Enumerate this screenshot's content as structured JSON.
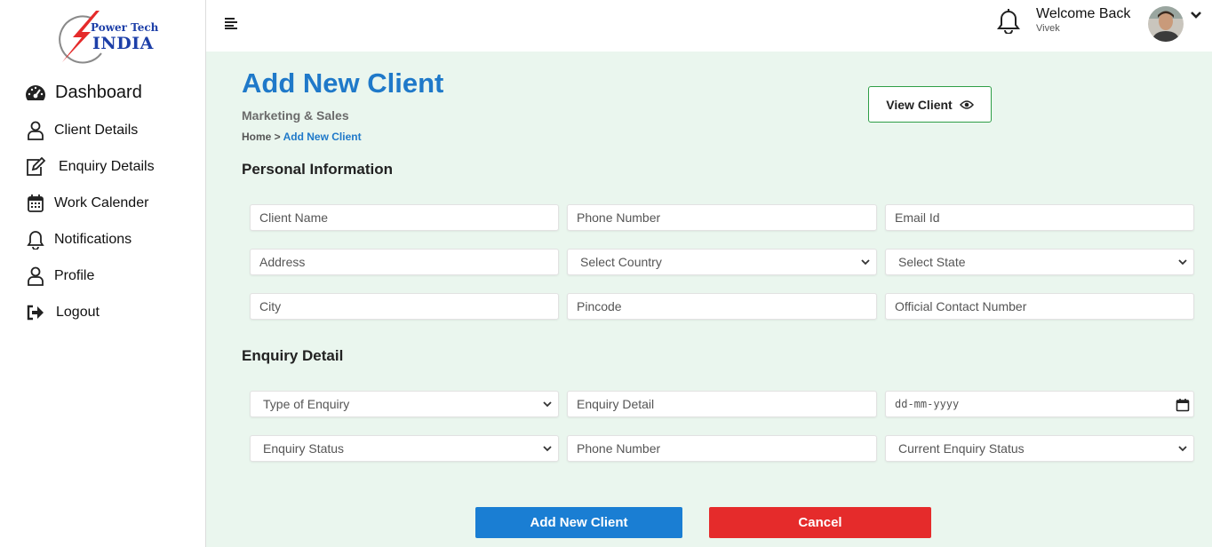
{
  "brand": {
    "line1": "Power Tech",
    "line2": "INDIA"
  },
  "sidebar": {
    "items": [
      {
        "label": "Dashboard",
        "icon": "speedometer-icon"
      },
      {
        "label": "Client Details",
        "icon": "user-icon"
      },
      {
        "label": "Enquiry Details",
        "icon": "edit-icon"
      },
      {
        "label": "Work Calender",
        "icon": "calendar-icon"
      },
      {
        "label": "Notifications",
        "icon": "bell-icon"
      },
      {
        "label": "Profile",
        "icon": "user-icon"
      },
      {
        "label": "Logout",
        "icon": "logout-icon"
      }
    ]
  },
  "header": {
    "welcome": "Welcome Back",
    "username": "Vivek"
  },
  "page": {
    "title": "Add New Client",
    "subtitle": "Marketing & Sales",
    "breadcrumb_home": "Home",
    "breadcrumb_sep": " > ",
    "breadcrumb_current": "Add New Client",
    "view_client_label": "View Client"
  },
  "personal": {
    "title": "Personal Information",
    "client_name": "Client Name",
    "phone": "Phone Number",
    "email": "Email Id",
    "address": "Address",
    "country": "Select Country",
    "state": "Select State",
    "city": "City",
    "pincode": "Pincode",
    "official_contact": "Official Contact Number"
  },
  "enquiry": {
    "title": "Enquiry Detail",
    "type": "Type of Enquiry",
    "detail": "Enquiry Detail",
    "date": "dd-mm-yyyy",
    "status": "Enquiry Status",
    "phone": "Phone Number",
    "current_status": "Current Enquiry Status"
  },
  "actions": {
    "add_label": "Add New Client",
    "cancel_label": "Cancel"
  },
  "colors": {
    "accent": "#1f79c9",
    "primary_button": "#1a7ed3",
    "danger_button": "#e52b2b",
    "main_background": "#eaf6ee",
    "view_button_border": "#2e9e46"
  }
}
